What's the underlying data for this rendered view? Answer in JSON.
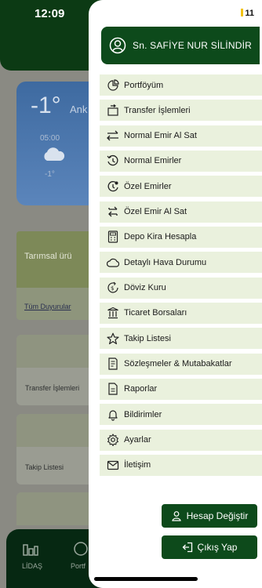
{
  "status_bar": {
    "time": "12:09",
    "battery": "11"
  },
  "background": {
    "weather": {
      "temperature": "-1°",
      "city": "Ank",
      "hour": "05:00",
      "hour_temp": "-1°"
    },
    "announcement": {
      "text": "Tarımsal ürü",
      "link": "Tüm Duyurular"
    },
    "shortcuts": [
      "Transfer İşlemleri",
      "Takip Listesi"
    ],
    "nav": [
      {
        "label": "LİDAŞ",
        "icon": "chart-icon"
      },
      {
        "label": "Portf",
        "icon": "portfolio-icon"
      }
    ]
  },
  "drawer": {
    "user_name": "Sn. SAFİYE NUR SİLİNDİR",
    "menu_items": [
      {
        "label": "Portföyüm",
        "icon": "pie-chart-icon"
      },
      {
        "label": "Transfer İşlemleri",
        "icon": "transfer-icon"
      },
      {
        "label": "Normal Emir Al Sat",
        "icon": "swap-arrows-icon"
      },
      {
        "label": "Normal Emirler",
        "icon": "history-icon"
      },
      {
        "label": "Özel Emirler",
        "icon": "special-order-icon"
      },
      {
        "label": "Özel Emir Al Sat",
        "icon": "special-swap-icon"
      },
      {
        "label": "Depo Kira Hesapla",
        "icon": "calculator-icon"
      },
      {
        "label": "Detaylı Hava Durumu",
        "icon": "cloud-icon"
      },
      {
        "label": "Döviz Kuru",
        "icon": "currency-icon"
      },
      {
        "label": "Ticaret Borsaları",
        "icon": "exchange-building-icon"
      },
      {
        "label": "Takip Listesi",
        "icon": "star-icon"
      },
      {
        "label": "Sözleşmeler & Mutabakatlar",
        "icon": "contract-icon"
      },
      {
        "label": "Raporlar",
        "icon": "report-icon"
      },
      {
        "label": "Bildirimler",
        "icon": "bell-icon"
      },
      {
        "label": "Ayarlar",
        "icon": "gear-icon"
      },
      {
        "label": "İletişim",
        "icon": "mail-icon"
      }
    ],
    "change_account_label": "Hesap Değiştir",
    "logout_label": "Çıkış Yap"
  },
  "colors": {
    "brand_green": "#0d4a1b",
    "menu_bg": "#eaf1dd",
    "battery": "#f2c20f"
  }
}
